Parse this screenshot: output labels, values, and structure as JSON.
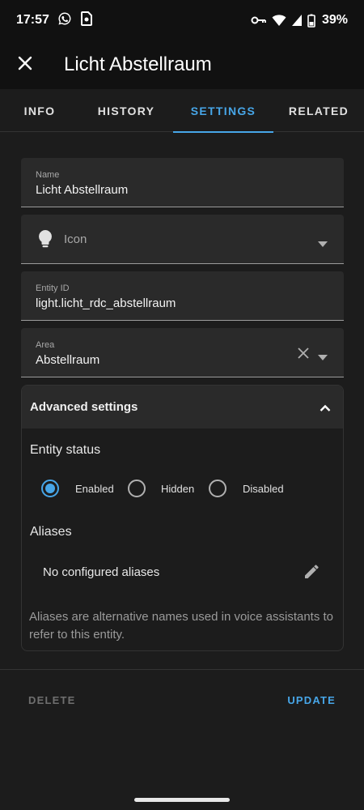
{
  "status_bar": {
    "time": "17:57",
    "battery": "39%",
    "icons": [
      "whatsapp-icon",
      "sim-card-icon",
      "key-icon",
      "wifi-icon",
      "signal-icon",
      "battery-icon"
    ]
  },
  "app_bar": {
    "title": "Licht Abstellraum",
    "close_icon": "close-icon"
  },
  "tabs": [
    {
      "label": "INFO",
      "active": false
    },
    {
      "label": "HISTORY",
      "active": false
    },
    {
      "label": "SETTINGS",
      "active": true
    },
    {
      "label": "RELATED",
      "active": false
    }
  ],
  "form": {
    "name": {
      "label": "Name",
      "value": "Licht Abstellraum"
    },
    "icon": {
      "placeholder": "Icon",
      "icon": "lightbulb-icon"
    },
    "entity_id": {
      "label": "Entity ID",
      "value": "light.licht_rdc_abstellraum"
    },
    "area": {
      "label": "Area",
      "value": "Abstellraum"
    }
  },
  "advanced": {
    "title": "Advanced settings",
    "expanded": true,
    "entity_status": {
      "title": "Entity status",
      "options": [
        {
          "label": "Enabled",
          "checked": true
        },
        {
          "label": "Hidden",
          "checked": false
        },
        {
          "label": "Disabled",
          "checked": false
        }
      ]
    },
    "aliases": {
      "title": "Aliases",
      "empty_text": "No configured aliases",
      "help_text": "Aliases are alternative names used in voice assistants to refer to this entity."
    }
  },
  "footer": {
    "delete_label": "DELETE",
    "update_label": "UPDATE"
  },
  "colors": {
    "accent": "#47a6e8",
    "background": "#1c1c1c",
    "surface": "#2a2a2a",
    "app_bar": "#111111"
  }
}
